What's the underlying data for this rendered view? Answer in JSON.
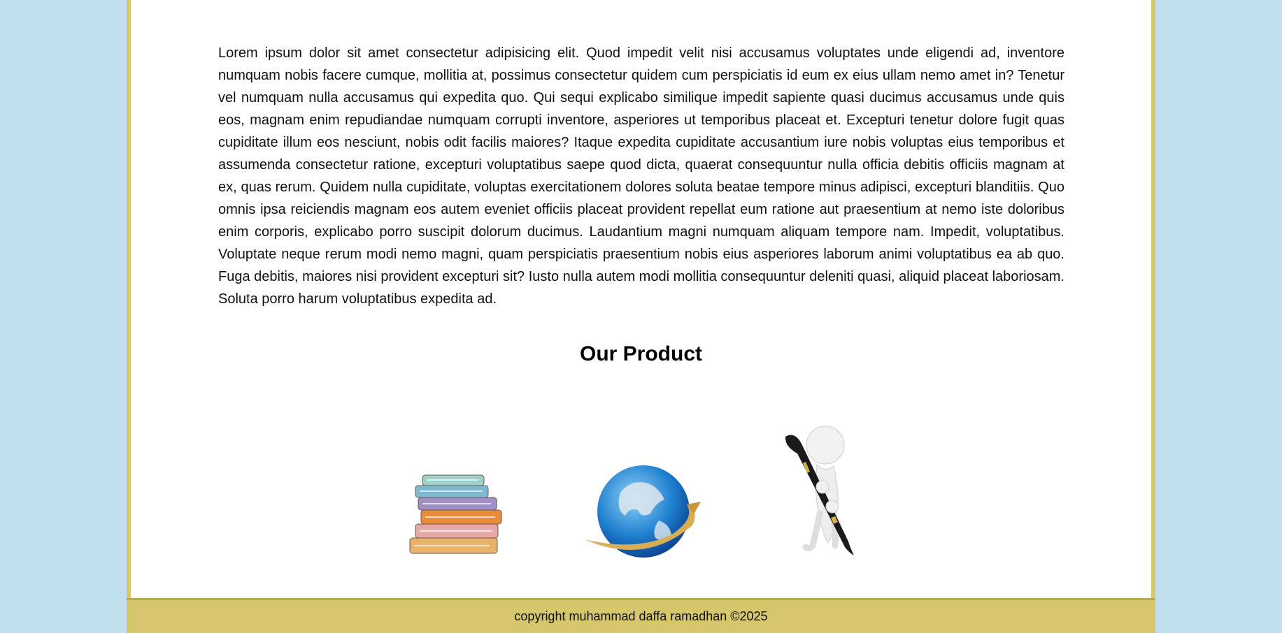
{
  "article": {
    "text": "Lorem ipsum dolor sit amet consectetur adipisicing elit. Quod impedit velit nisi accusamus voluptates unde eligendi ad, inventore numquam nobis facere cumque, mollitia at, possimus consectetur quidem cum perspiciatis id eum ex eius ullam nemo amet in? Tenetur vel numquam nulla accusamus qui expedita quo. Qui sequi explicabo similique impedit sapiente quasi ducimus accusamus unde quis eos, magnam enim repudiandae numquam corrupti inventore, asperiores ut temporibus placeat et. Excepturi tenetur dolore fugit quas cupiditate illum eos nesciunt, nobis odit facilis maiores? Itaque expedita cupiditate accusantium iure nobis voluptas eius temporibus et assumenda consectetur ratione, excepturi voluptatibus saepe quod dicta, quaerat consequuntur nulla officia debitis officiis magnam at ex, quas rerum. Quidem nulla cupiditate, voluptas exercitationem dolores soluta beatae tempore minus adipisci, excepturi blanditiis. Quo omnis ipsa reiciendis magnam eos autem eveniet officiis placeat provident repellat eum ratione aut praesentium at nemo iste doloribus enim corporis, explicabo porro suscipit dolorum ducimus. Laudantium magni numquam aliquam tempore nam. Impedit, voluptatibus. Voluptate neque rerum modi nemo magni, quam perspiciatis praesentium nobis eius asperiores laborum animi voluptatibus ea ab quo. Fuga debitis, maiores nisi provident excepturi sit? Iusto nulla autem modi mollitia consequuntur deleniti quasi, aliquid placeat laboriosam. Soluta porro harum voluptatibus expedita ad."
  },
  "products": {
    "heading": "Our Product",
    "items": [
      {
        "icon": "books-stack-icon"
      },
      {
        "icon": "globe-icon"
      },
      {
        "icon": "figure-with-pen-icon"
      }
    ]
  },
  "footer": {
    "text": "copyright muhammad daffa ramadhan ©2025"
  },
  "colors": {
    "background": "#bfe0ec",
    "frame": "#d6c76c",
    "content": "#ffffff"
  }
}
